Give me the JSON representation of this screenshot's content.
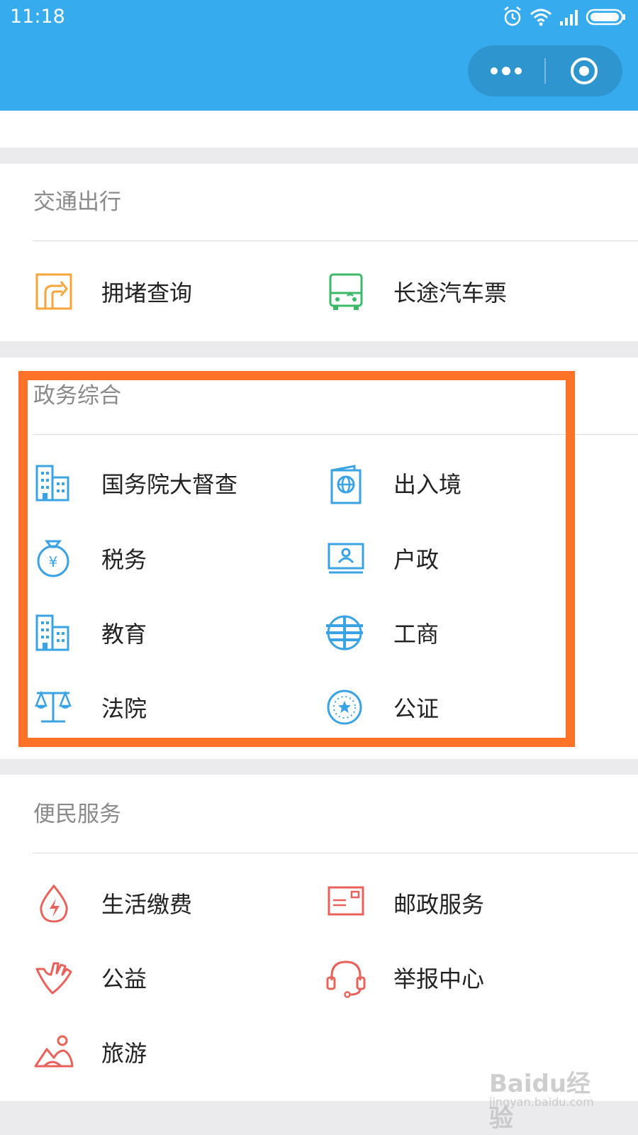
{
  "status_bar": {
    "time": "11:18"
  },
  "nav": {
    "more_icon": "more-dots-icon",
    "close_icon": "close-target-icon"
  },
  "sections": {
    "transport": {
      "title": "交通出行",
      "items": [
        {
          "label": "拥堵查询",
          "icon": "road-turn-icon"
        },
        {
          "label": "长途汽车票",
          "icon": "bus-icon"
        }
      ]
    },
    "government": {
      "title": "政务综合",
      "items": [
        {
          "label": "国务院大督查",
          "icon": "building-icon"
        },
        {
          "label": "出入境",
          "icon": "passport-icon"
        },
        {
          "label": "税务",
          "icon": "money-bag-icon"
        },
        {
          "label": "户政",
          "icon": "id-card-icon"
        },
        {
          "label": "教育",
          "icon": "building-icon"
        },
        {
          "label": "工商",
          "icon": "seal-emblem-icon"
        },
        {
          "label": "法院",
          "icon": "scales-icon"
        },
        {
          "label": "公证",
          "icon": "badge-star-icon"
        }
      ]
    },
    "convenience": {
      "title": "便民服务",
      "items": [
        {
          "label": "生活缴费",
          "icon": "utility-drop-icon"
        },
        {
          "label": "邮政服务",
          "icon": "mail-icon"
        },
        {
          "label": "公益",
          "icon": "charity-hand-icon"
        },
        {
          "label": "举报中心",
          "icon": "headset-icon"
        },
        {
          "label": "旅游",
          "icon": "travel-icon"
        }
      ]
    }
  },
  "colors": {
    "nav": "#36acee",
    "transport_orange": "#f5a53b",
    "transport_green": "#3cb96a",
    "gov_blue": "#3aa3e3",
    "service_red": "#e8625b",
    "highlight": "#fc7226"
  },
  "watermark": {
    "brand": "Baidu经验",
    "url": "jingyan.baidu.com"
  }
}
